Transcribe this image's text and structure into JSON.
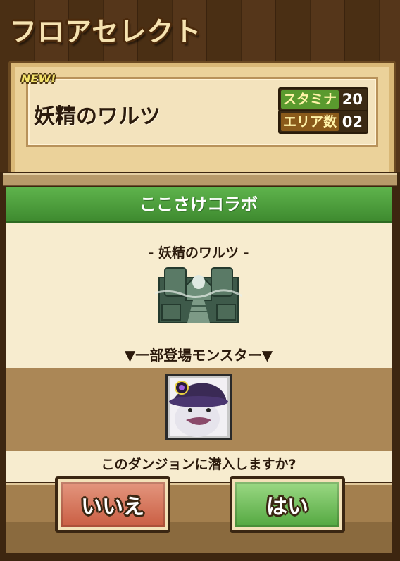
{
  "header": {
    "title": "フロアセレクト"
  },
  "floor_card": {
    "badge": "NEW!",
    "name": "妖精のワルツ",
    "stamina_label": "スタミナ",
    "stamina_value": "20",
    "area_label": "エリア数",
    "area_value": "02"
  },
  "dialog": {
    "title": "ここさけコラボ",
    "dungeon_name": "- 妖精のワルツ -",
    "monsters_heading": "▼一部登場モンスター▼",
    "confirm_text": "このダンジョンに潜入しますか?",
    "no_button": "いいえ",
    "yes_button": "はい"
  },
  "colors": {
    "title_bar_green": "#4fa43c",
    "no_button": "#c85a3f",
    "yes_button": "#4fa43c",
    "stamina_label_bg": "#5a9a2e",
    "area_label_bg": "#8a5a1a"
  }
}
